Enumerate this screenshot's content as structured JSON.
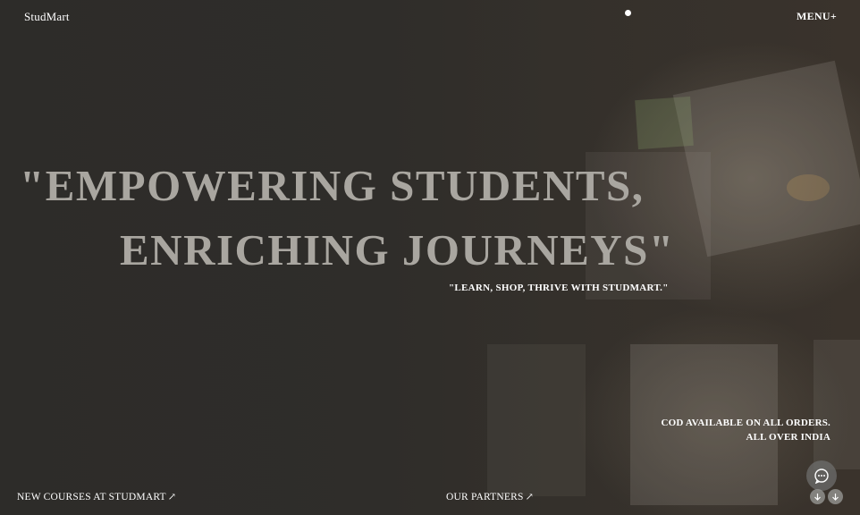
{
  "header": {
    "brand": "StudMart",
    "menu_label": "MENU+"
  },
  "hero": {
    "headline_line1": "\"EMPOWERING STUDENTS,",
    "headline_line2": "ENRICHING JOURNEYS\"",
    "tagline": "\"LEARN, SHOP, THRIVE WITH STUDMART.\""
  },
  "notice": {
    "line1": "COD AVAILABLE ON ALL ORDERS.",
    "line2": "ALL OVER INDIA"
  },
  "footer_links": {
    "courses": "NEW COURSES AT STUDMART",
    "partners": "OUR PARTNERS",
    "arrow_glyph": "↗"
  },
  "widgets": {
    "chat_icon": "chat-bubble-icon",
    "scroll_icon": "arrow-down-icon"
  },
  "colors": {
    "background": "#2a2926",
    "headline": "#a9a6a0",
    "text": "#ffffff"
  }
}
